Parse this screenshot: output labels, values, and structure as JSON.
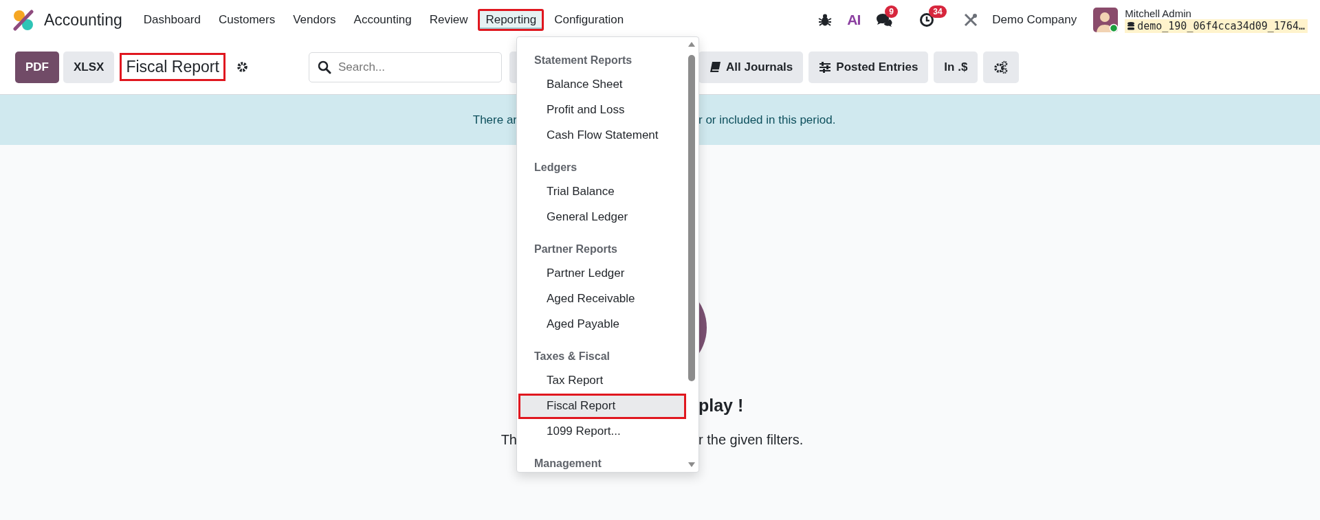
{
  "app": {
    "name": "Accounting"
  },
  "nav": [
    {
      "label": "Dashboard",
      "selected": false,
      "highlighted": false
    },
    {
      "label": "Customers",
      "selected": false,
      "highlighted": false
    },
    {
      "label": "Vendors",
      "selected": false,
      "highlighted": false
    },
    {
      "label": "Accounting",
      "selected": false,
      "highlighted": false
    },
    {
      "label": "Review",
      "selected": false,
      "highlighted": false
    },
    {
      "label": "Reporting",
      "selected": true,
      "highlighted": true
    },
    {
      "label": "Configuration",
      "selected": false,
      "highlighted": false
    }
  ],
  "systray": {
    "ai_label": "AI",
    "messages_badge": "9",
    "activities_badge": "34",
    "company": "Demo Company",
    "user": "Mitchell Admin",
    "database": "demo_190_06f4cca34d09_1764…"
  },
  "toolbar": {
    "export_buttons": [
      {
        "label": "PDF",
        "kind": "primary"
      },
      {
        "label": "XLSX",
        "kind": "secondary"
      }
    ],
    "report_title": {
      "text": "Fiscal Report",
      "highlighted": true
    },
    "search": {
      "placeholder": "Search..."
    },
    "filters": [
      {
        "kind": "covered"
      },
      {
        "label": "All Journals",
        "kind": "journals"
      },
      {
        "label": "Posted Entries",
        "kind": "entries"
      },
      {
        "label": "In .$",
        "kind": "text"
      },
      {
        "kind": "options"
      }
    ]
  },
  "banner": {
    "text_before": "There ar",
    "text_after": "r or included in this period."
  },
  "empty_state": {
    "title_after": "play !",
    "text_before": "Th",
    "text_after": "r the given filters."
  },
  "menu": {
    "sections": [
      {
        "title": "Statement Reports",
        "items": [
          {
            "label": "Balance Sheet",
            "selected": false,
            "highlighted": false
          },
          {
            "label": "Profit and Loss",
            "selected": false,
            "highlighted": false
          },
          {
            "label": "Cash Flow Statement",
            "selected": false,
            "highlighted": false
          }
        ]
      },
      {
        "title": "Ledgers",
        "items": [
          {
            "label": "Trial Balance",
            "selected": false,
            "highlighted": false
          },
          {
            "label": "General Ledger",
            "selected": false,
            "highlighted": false
          }
        ]
      },
      {
        "title": "Partner Reports",
        "items": [
          {
            "label": "Partner Ledger",
            "selected": false,
            "highlighted": false
          },
          {
            "label": "Aged Receivable",
            "selected": false,
            "highlighted": false
          },
          {
            "label": "Aged Payable",
            "selected": false,
            "highlighted": false
          }
        ]
      },
      {
        "title": "Taxes & Fiscal",
        "items": [
          {
            "label": "Tax Report",
            "selected": false,
            "highlighted": false
          },
          {
            "label": "Fiscal Report",
            "selected": true,
            "highlighted": true
          },
          {
            "label": "1099 Report...",
            "selected": false,
            "highlighted": false
          }
        ]
      },
      {
        "title": "Management"
      }
    ]
  }
}
